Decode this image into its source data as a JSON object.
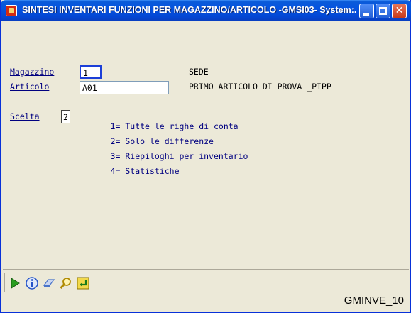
{
  "window": {
    "title": "SINTESI INVENTARI FUNZIONI PER MAGAZZINO/ARTICOLO -GMSI03- System:..."
  },
  "form": {
    "magazzino": {
      "label": "Magazzino",
      "value": "1",
      "description": "SEDE"
    },
    "articolo": {
      "label": "Articolo",
      "value": "A01",
      "description": "PRIMO ARTICOLO DI PROVA _PIPP"
    },
    "scelta": {
      "label": "Scelta",
      "value": "2",
      "options": [
        {
          "key": "1=",
          "text": "Tutte le righe di conta"
        },
        {
          "key": "2=",
          "text": "Solo le differenze"
        },
        {
          "key": "3=",
          "text": "Riepiloghi per inventario"
        },
        {
          "key": "4=",
          "text": "Statistiche"
        }
      ]
    }
  },
  "toolbar": {
    "buttons": [
      {
        "name": "run-icon",
        "color": "#2a9d1f"
      },
      {
        "name": "info-icon",
        "color": "#2453c8"
      },
      {
        "name": "eraser-icon",
        "color": "#4a74c9"
      },
      {
        "name": "search-icon",
        "color": "#e0b400"
      },
      {
        "name": "exit-icon",
        "color": "#d4b800"
      }
    ]
  },
  "footer": {
    "code": "GMINVE_10"
  }
}
